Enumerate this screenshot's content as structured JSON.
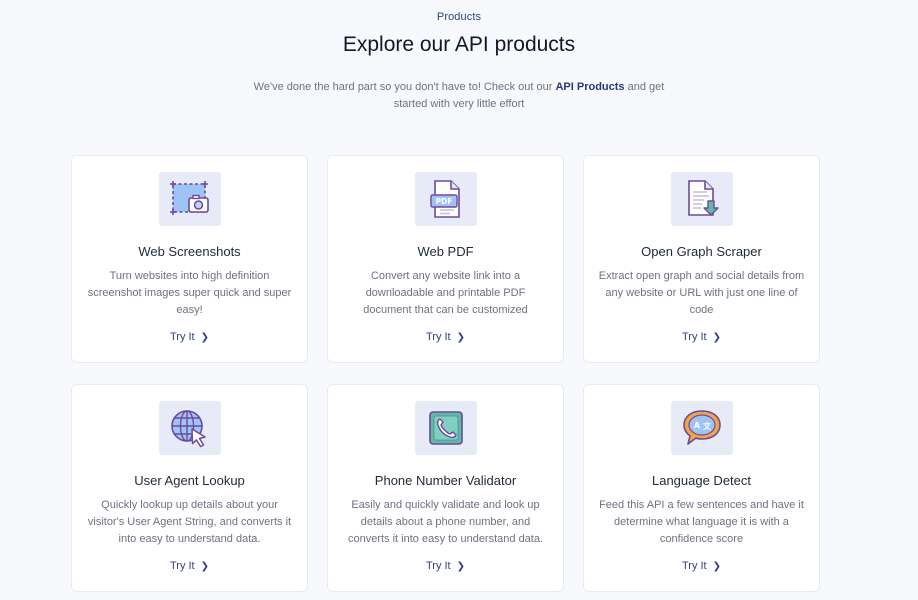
{
  "section": {
    "eyebrow": "Products",
    "title": "Explore our API products",
    "intro_before": "We've done the hard part so you don't have to! Check out our ",
    "intro_link": "API Products",
    "intro_after": " and get started with very little effort"
  },
  "colors": {
    "accent": "#2f3f86",
    "tile_bg": "#e7ebf8",
    "page_bg": "#f8f9fd"
  },
  "products": [
    {
      "icon": "screenshot-icon",
      "title": "Web Screenshots",
      "description": "Turn websites into high definition screenshot images super quick and super easy!",
      "cta": "Try It"
    },
    {
      "icon": "pdf-icon",
      "title": "Web PDF",
      "description": "Convert any website link into a downloadable and printable PDF document that can be customized",
      "cta": "Try It"
    },
    {
      "icon": "document-download-icon",
      "title": "Open Graph Scraper",
      "description": "Extract open graph and social details from any website or URL with just one line of code",
      "cta": "Try It"
    },
    {
      "icon": "globe-cursor-icon",
      "title": "User Agent Lookup",
      "description": "Quickly lookup up details about your visitor's User Agent String, and converts it into easy to understand data.",
      "cta": "Try It"
    },
    {
      "icon": "phone-icon",
      "title": "Phone Number Validator",
      "description": "Easily and quickly validate and look up details about a phone number, and converts it into easy to understand data.",
      "cta": "Try It"
    },
    {
      "icon": "language-bubble-icon",
      "title": "Language Detect",
      "description": "Feed this API a few sentences and have it determine what language it is with a confidence score",
      "cta": "Try It"
    }
  ]
}
